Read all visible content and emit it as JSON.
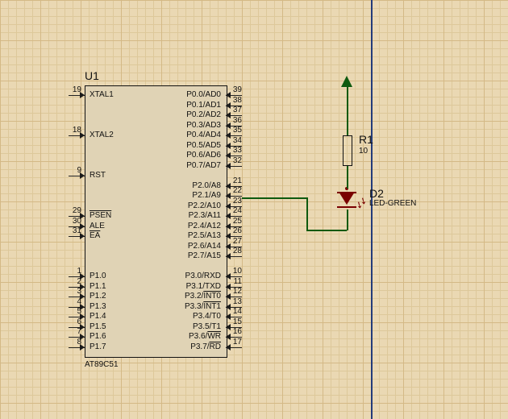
{
  "ic": {
    "ref": "U1",
    "part": "AT89C51",
    "leftPins": [
      {
        "pos": 0,
        "num": "19",
        "name": "XTAL1",
        "inv": false
      },
      {
        "pos": 4,
        "num": "18",
        "name": "XTAL2",
        "inv": false
      },
      {
        "pos": 8,
        "num": "9",
        "name": "RST",
        "inv": false
      },
      {
        "pos": 12,
        "num": "29",
        "name": "PSEN",
        "inv": true
      },
      {
        "pos": 13,
        "num": "30",
        "name": "ALE",
        "inv": false
      },
      {
        "pos": 14,
        "num": "31",
        "name": "EA",
        "inv": true
      },
      {
        "pos": 18,
        "num": "1",
        "name": "P1.0",
        "inv": false
      },
      {
        "pos": 19,
        "num": "2",
        "name": "P1.1",
        "inv": false
      },
      {
        "pos": 20,
        "num": "3",
        "name": "P1.2",
        "inv": false
      },
      {
        "pos": 21,
        "num": "4",
        "name": "P1.3",
        "inv": false
      },
      {
        "pos": 22,
        "num": "5",
        "name": "P1.4",
        "inv": false
      },
      {
        "pos": 23,
        "num": "6",
        "name": "P1.5",
        "inv": false
      },
      {
        "pos": 24,
        "num": "7",
        "name": "P1.6",
        "inv": false
      },
      {
        "pos": 25,
        "num": "8",
        "name": "P1.7",
        "inv": false
      }
    ],
    "rightPins": [
      {
        "pos": 0,
        "num": "39",
        "name": "P0.0/AD0"
      },
      {
        "pos": 1,
        "num": "38",
        "name": "P0.1/AD1"
      },
      {
        "pos": 2,
        "num": "37",
        "name": "P0.2/AD2"
      },
      {
        "pos": 3,
        "num": "36",
        "name": "P0.3/AD3"
      },
      {
        "pos": 4,
        "num": "35",
        "name": "P0.4/AD4"
      },
      {
        "pos": 5,
        "num": "34",
        "name": "P0.5/AD5"
      },
      {
        "pos": 6,
        "num": "33",
        "name": "P0.6/AD6"
      },
      {
        "pos": 7,
        "num": "32",
        "name": "P0.7/AD7"
      },
      {
        "pos": 9,
        "num": "21",
        "name": "P2.0/A8"
      },
      {
        "pos": 10,
        "num": "22",
        "name": "P2.1/A9"
      },
      {
        "pos": 11,
        "num": "23",
        "name": "P2.2/A10"
      },
      {
        "pos": 12,
        "num": "24",
        "name": "P2.3/A11"
      },
      {
        "pos": 13,
        "num": "25",
        "name": "P2.4/A12"
      },
      {
        "pos": 14,
        "num": "26",
        "name": "P2.5/A13"
      },
      {
        "pos": 15,
        "num": "27",
        "name": "P2.6/A14"
      },
      {
        "pos": 16,
        "num": "28",
        "name": "P2.7/A15"
      },
      {
        "pos": 18,
        "num": "10",
        "name": "P3.0/RXD"
      },
      {
        "pos": 19,
        "num": "11",
        "name": "P3.1/TXD"
      },
      {
        "pos": 20,
        "num": "12",
        "name": "P3.2/",
        "suffixInv": "INT0"
      },
      {
        "pos": 21,
        "num": "13",
        "name": "P3.3/",
        "suffixInv": "INT1"
      },
      {
        "pos": 22,
        "num": "14",
        "name": "P3.4/T0"
      },
      {
        "pos": 23,
        "num": "15",
        "name": "P3.5/T1"
      },
      {
        "pos": 24,
        "num": "16",
        "name": "P3.6/",
        "suffixInv": "WR"
      },
      {
        "pos": 25,
        "num": "17",
        "name": "P3.7/",
        "suffixInv": "RD"
      }
    ]
  },
  "resistor": {
    "ref": "R1",
    "value": "10"
  },
  "led": {
    "ref": "D2",
    "part": "LED-GREEN"
  }
}
